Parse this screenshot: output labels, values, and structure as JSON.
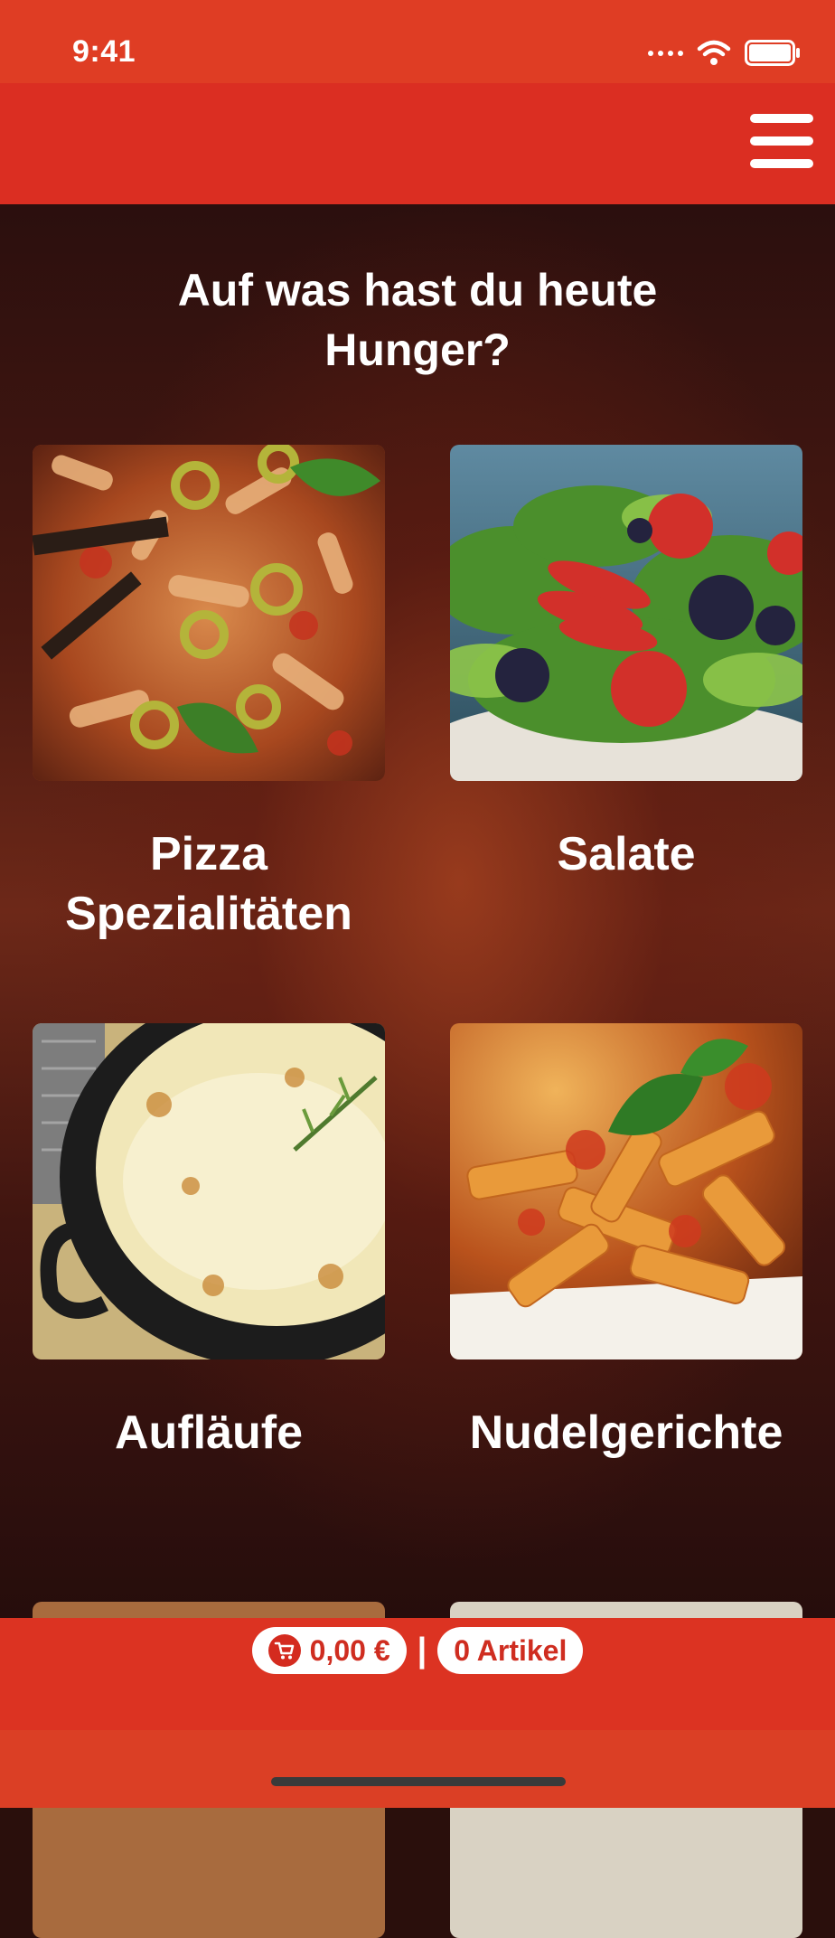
{
  "status_bar": {
    "time": "9:41",
    "icons": [
      "signal-dots-icon",
      "wifi-icon",
      "battery-icon"
    ]
  },
  "header": {
    "menu_icon": "hamburger-menu-icon",
    "background": "#db2e22"
  },
  "page": {
    "title": "Auf was hast du heute\nHunger?"
  },
  "categories": [
    {
      "label": "Pizza\nSpezialitäten",
      "image": "pizza-image"
    },
    {
      "label": "Salate",
      "image": "salad-image"
    },
    {
      "label": "Aufläufe",
      "image": "casserole-image"
    },
    {
      "label": "Nudelgerichte",
      "image": "pasta-image"
    }
  ],
  "cart": {
    "total": "0,00 €",
    "separator": "|",
    "items": "0 Artikel",
    "icon": "cart-icon"
  },
  "colors": {
    "accent": "#db2e22",
    "text": "#ffffff",
    "pill_text": "#cf2d20"
  }
}
